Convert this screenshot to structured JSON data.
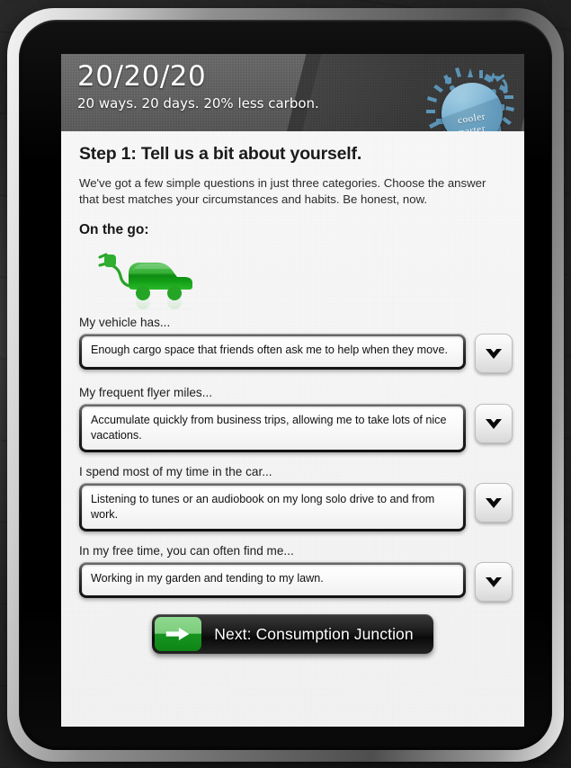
{
  "brand": {
    "title": "20/20/20",
    "tagline": "20 ways. 20 days. 20% less carbon.",
    "badge_line1": "cooler",
    "badge_line2": "smarter",
    "badge_color": "#6fabcf"
  },
  "page": {
    "step_title": "Step 1: Tell us a bit about yourself.",
    "step_description": "We've got a few simple questions in just three categories. Choose the answer that best matches your circumstances and habits. Be honest, now.",
    "section_title": "On the go:",
    "section_icon": "electric-car-icon",
    "section_icon_color": "#22a022"
  },
  "questions": [
    {
      "label": "My vehicle has...",
      "value": "Enough cargo space that friends often ask me to help when they move."
    },
    {
      "label": "My frequent flyer miles...",
      "value": "Accumulate quickly from business trips, allowing me to take lots of nice vacations."
    },
    {
      "label": "I spend most of my time in the car...",
      "value": "Listening to tunes or an audiobook on my long solo drive to and from work."
    },
    {
      "label": "In my free time, you can often find me...",
      "value": "Working in my garden and tending to my lawn."
    }
  ],
  "next_button": {
    "label": "Next: Consumption Junction",
    "icon": "arrow-right-icon",
    "accent_color": "#17941f"
  }
}
